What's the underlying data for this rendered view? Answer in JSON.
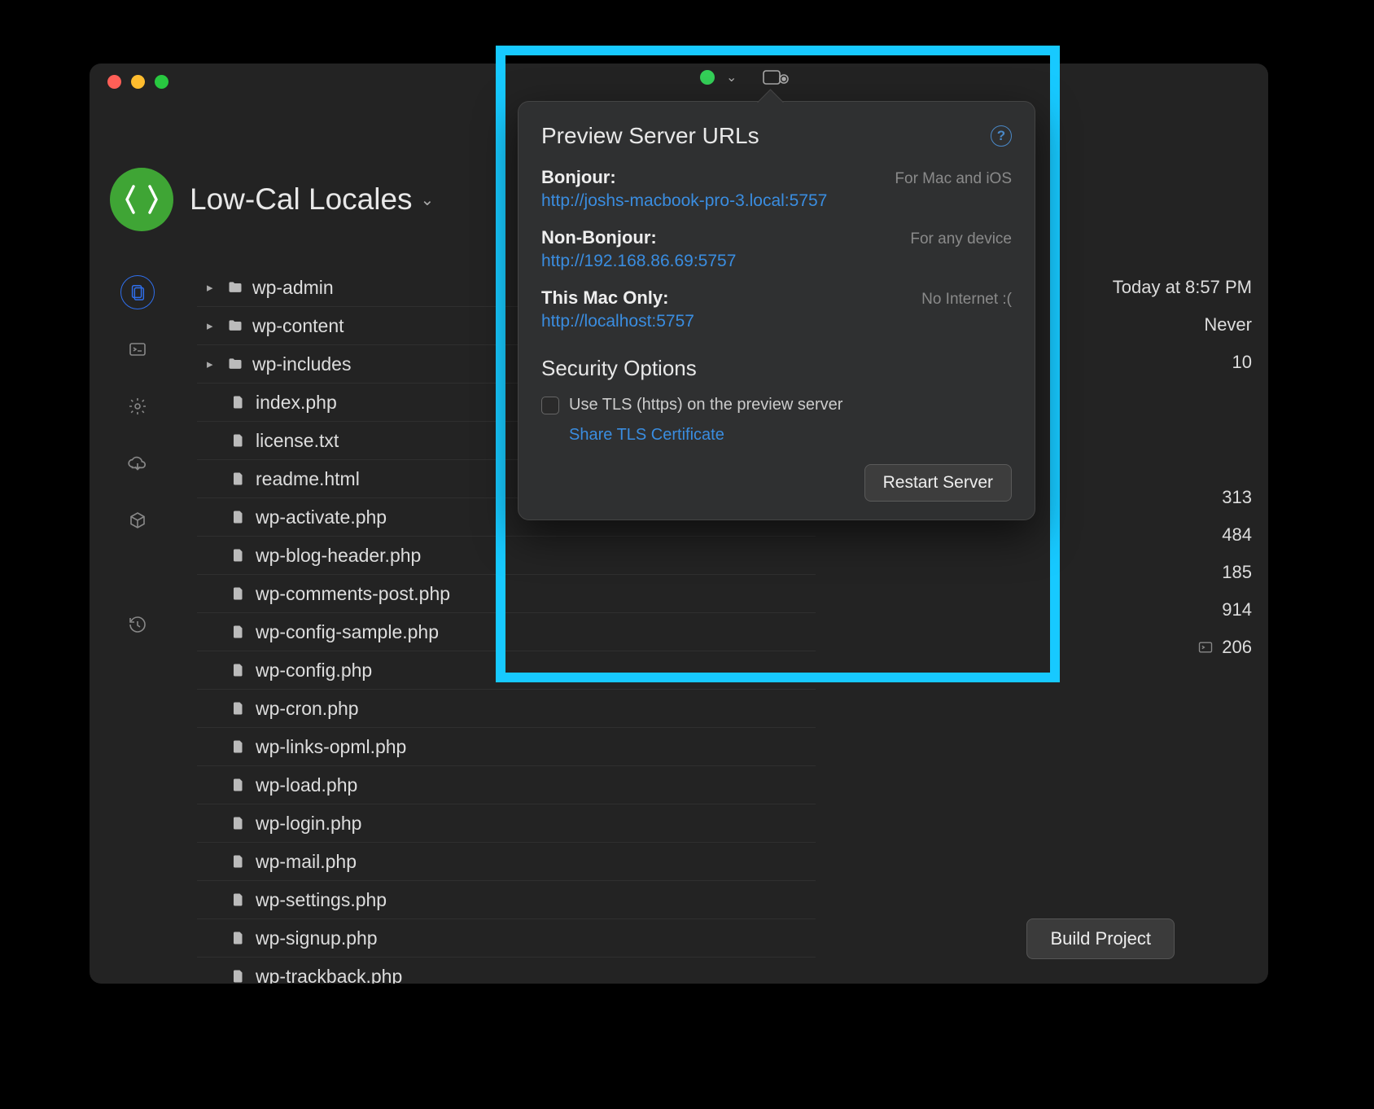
{
  "project": {
    "title": "Low-Cal Locales"
  },
  "tree": {
    "folders": [
      "wp-admin",
      "wp-content",
      "wp-includes"
    ],
    "files": [
      "index.php",
      "license.txt",
      "readme.html",
      "wp-activate.php",
      "wp-blog-header.php",
      "wp-comments-post.php",
      "wp-config-sample.php",
      "wp-config.php",
      "wp-cron.php",
      "wp-links-opml.php",
      "wp-load.php",
      "wp-login.php",
      "wp-mail.php",
      "wp-settings.php",
      "wp-signup.php",
      "wp-trackback.php"
    ]
  },
  "info": {
    "modified": "Today at 8:57 PM",
    "never": "Never",
    "count_top": "10",
    "rows": [
      "313",
      "484",
      "185",
      "914",
      "206"
    ]
  },
  "buttons": {
    "build": "Build Project",
    "restart": "Restart Server"
  },
  "popover": {
    "title": "Preview Server URLs",
    "bonjour_label": "Bonjour:",
    "bonjour_note": "For Mac and iOS",
    "bonjour_url": "http://joshs-macbook-pro-3.local:5757",
    "nonbonjour_label": "Non-Bonjour:",
    "nonbonjour_note": "For any device",
    "nonbonjour_url": "http://192.168.86.69:5757",
    "local_label": "This Mac Only:",
    "local_note": "No Internet :(",
    "local_url": "http://localhost:5757",
    "security_title": "Security Options",
    "tls_label": "Use TLS (https) on the preview server",
    "share_tls": "Share TLS Certificate"
  }
}
